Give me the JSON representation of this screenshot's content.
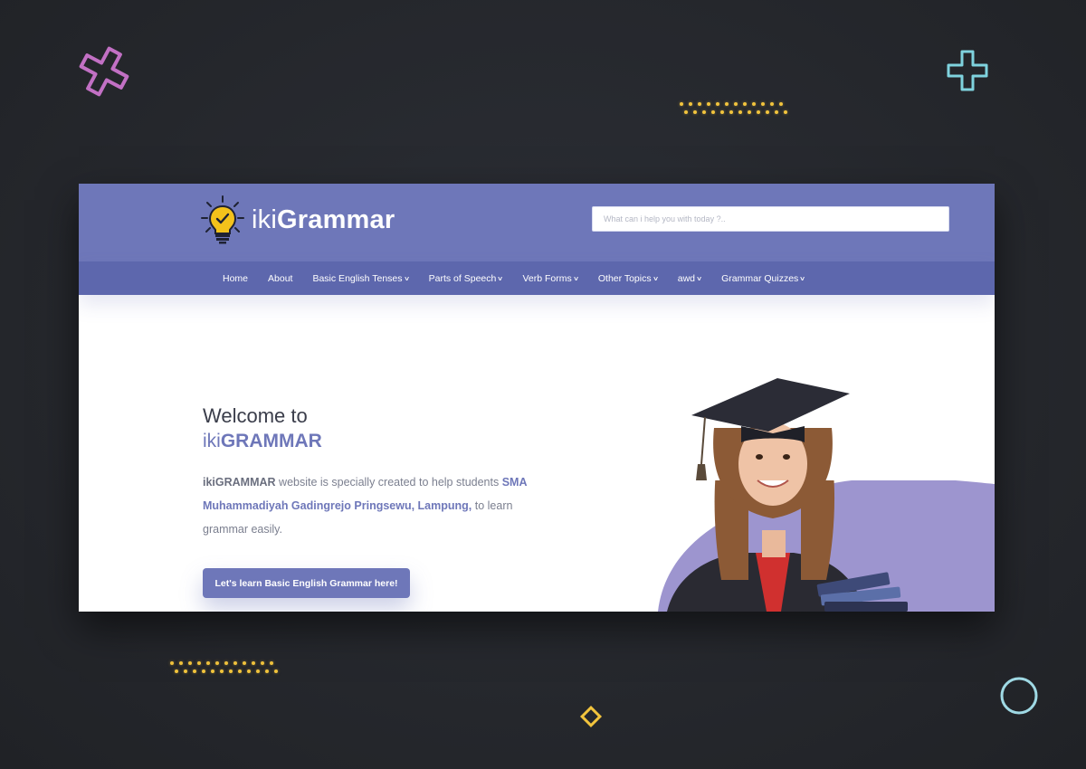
{
  "header": {
    "brand_light": "iki",
    "brand_bold": "Grammar",
    "search_placeholder": "What can i help you with today ?.."
  },
  "nav": {
    "items": [
      {
        "label": "Home"
      },
      {
        "label": "About"
      },
      {
        "label": "Basic English Tenses",
        "dropdown": true
      },
      {
        "label": "Parts of Speech",
        "dropdown": true
      },
      {
        "label": "Verb Forms",
        "dropdown": true
      },
      {
        "label": "Other Topics",
        "dropdown": true
      },
      {
        "label": "awd",
        "dropdown": true
      },
      {
        "label": "Grammar Quizzes",
        "dropdown": true
      }
    ]
  },
  "hero": {
    "welcome": "Welcome to",
    "brand_prefix": "iki",
    "brand_main": "GRAMMAR",
    "desc_strong": "ikiGRAMMAR",
    "desc_1": " website is specially created to help students ",
    "desc_accent": "SMA Muhammadiyah Gadingrejo Pringsewu, Lampung,",
    "desc_2": " to learn grammar easily.",
    "cta_label": "Let's learn Basic English Grammar here!"
  },
  "colors": {
    "topbar": "#6e77b9",
    "navbar": "#5d67ad",
    "accent": "#6e77b9",
    "page_bg": "#26282d",
    "dots": "#f2c43d",
    "pink_cross": "#c270c4",
    "cyan_cross": "#7fd3de",
    "circle": "#9fd9e4",
    "diamond": "#f2c43d"
  }
}
